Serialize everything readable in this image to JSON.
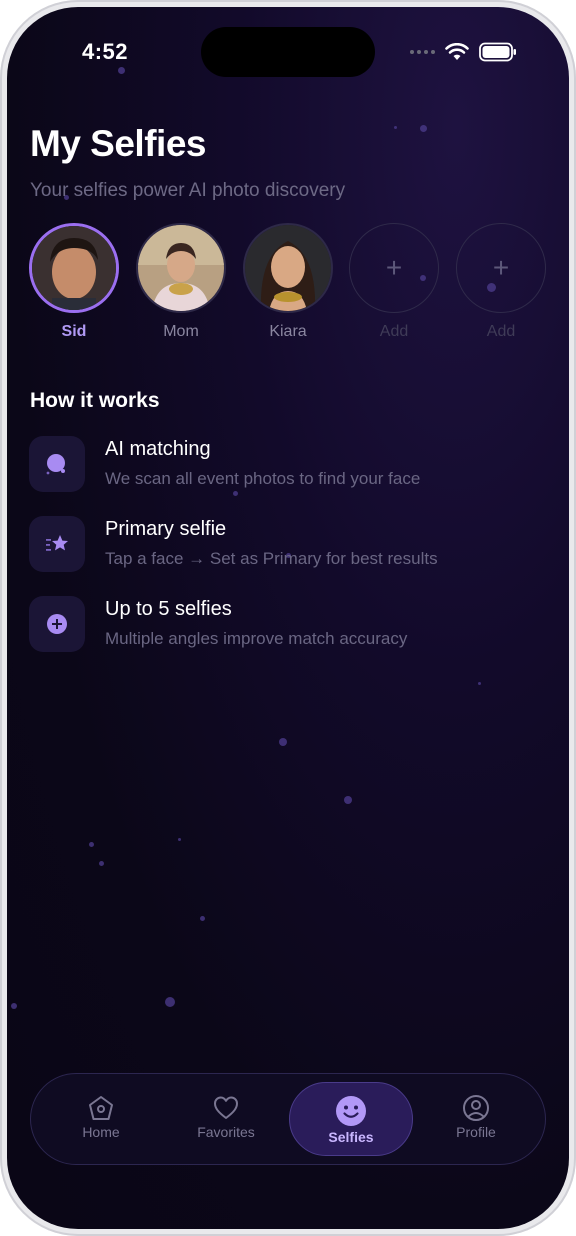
{
  "status_bar": {
    "time": "4:52"
  },
  "header": {
    "title": "My Selfies",
    "subtitle": "Your selfies power AI photo discovery"
  },
  "selfies": [
    {
      "label": "Sid",
      "primary": true
    },
    {
      "label": "Mom",
      "primary": false
    },
    {
      "label": "Kiara",
      "primary": false
    },
    {
      "label": "Add",
      "add": true
    },
    {
      "label": "Add",
      "add": true
    }
  ],
  "how_it_works": {
    "title": "How it works",
    "items": [
      {
        "icon": "ai-face-icon",
        "title": "AI matching",
        "description": "We scan all event photos to find your face"
      },
      {
        "icon": "star-icon",
        "title": "Primary selfie",
        "description": "Tap a face → Set as Primary for best results"
      },
      {
        "icon": "plus-circle-icon",
        "title": "Up to 5 selfies",
        "description": "Multiple angles improve match accuracy"
      }
    ]
  },
  "tab_bar": {
    "tabs": [
      {
        "label": "Home",
        "icon": "home-icon",
        "active": false
      },
      {
        "label": "Favorites",
        "icon": "heart-icon",
        "active": false
      },
      {
        "label": "Selfies",
        "icon": "smiley-icon",
        "active": true
      },
      {
        "label": "Profile",
        "icon": "profile-icon",
        "active": false
      }
    ]
  },
  "colors": {
    "accent": "#9b6ff0",
    "background": "#0b0718",
    "active_tab": "#2a1c5a"
  }
}
